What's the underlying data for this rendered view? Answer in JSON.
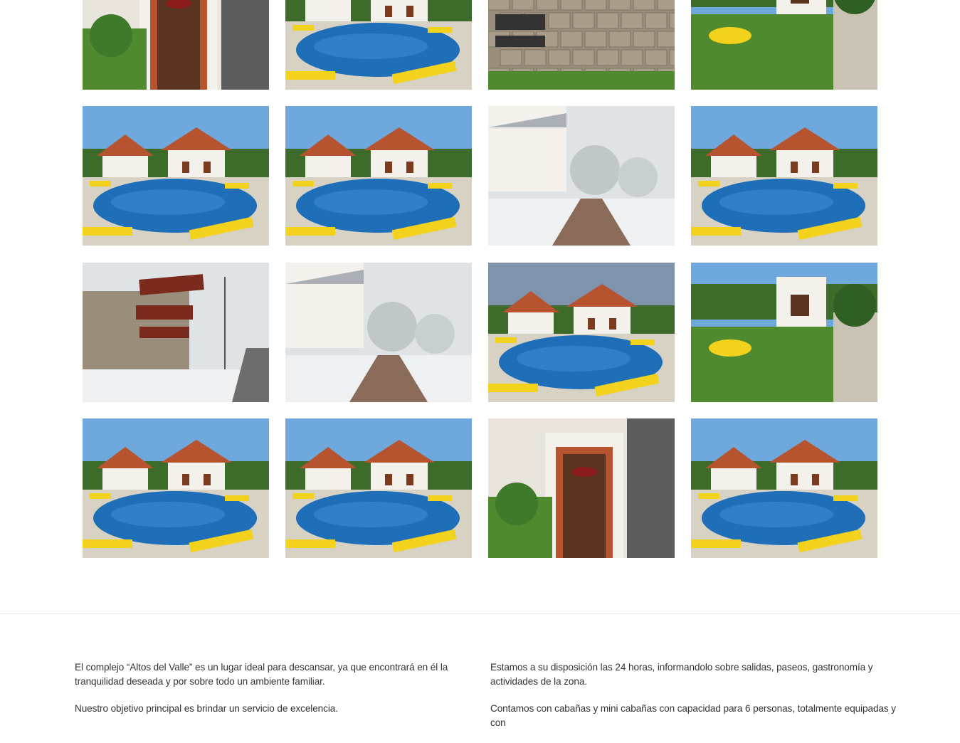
{
  "gallery": {
    "rows": [
      [
        {
          "name": "photo-entrance-night",
          "scene": "entrance",
          "description": "Entrance with door and lamp"
        },
        {
          "name": "photo-pool-day",
          "scene": "pool",
          "description": "Pool with yellow loungers"
        },
        {
          "name": "photo-stone-sign",
          "scene": "stonewall",
          "description": "Stone wall with sign"
        },
        {
          "name": "photo-garden-lawn",
          "scene": "garden",
          "description": "Garden lawn with tables"
        }
      ],
      [
        {
          "name": "photo-pool-house-1",
          "scene": "pool",
          "description": "Pool and houses"
        },
        {
          "name": "photo-pool-fence",
          "scene": "pool",
          "description": "Pool behind fence"
        },
        {
          "name": "photo-snow-path",
          "scene": "snow",
          "description": "Snowy path"
        },
        {
          "name": "photo-pool-house-2",
          "scene": "pool",
          "description": "Pool and houses"
        }
      ],
      [
        {
          "name": "photo-snow-sign",
          "scene": "snowsign",
          "description": "Sign in snow"
        },
        {
          "name": "photo-snow-courtyard",
          "scene": "snow",
          "description": "Snowy courtyard"
        },
        {
          "name": "photo-pool-evening",
          "scene": "pooldusk",
          "description": "Pool at dusk"
        },
        {
          "name": "photo-garden-house",
          "scene": "garden",
          "description": "Garden house"
        }
      ],
      [
        {
          "name": "photo-pool-wide-1",
          "scene": "pool",
          "description": "Wide pool view"
        },
        {
          "name": "photo-pool-wide-2",
          "scene": "pool",
          "description": "Pool with loungers"
        },
        {
          "name": "photo-sauna-door",
          "scene": "entrance",
          "description": "Sauna door"
        },
        {
          "name": "photo-pool-wide-3",
          "scene": "pool",
          "description": "Pool and deck"
        }
      ]
    ]
  },
  "info": {
    "left": {
      "p1": "El complejo “Altos del Valle” es un lugar ideal para descansar, ya que encontrará en él la tranquilidad deseada y por sobre todo un ambiente familiar.",
      "p2": "Nuestro objetivo principal es brindar un servicio de excelencia."
    },
    "right": {
      "p1": "Estamos a su disposición las 24 horas, informandolo sobre salidas, paseos, gastronomía y actividades de la zona.",
      "p2": "Contamos con cabañas y mini cabañas con capacidad para 6 personas, totalmente equipadas y con"
    }
  },
  "colors": {
    "pool": "#1f6fb8",
    "lounger": "#f2d21c",
    "roof": "#b5542f",
    "wall": "#f4f1ec",
    "grass": "#4f8a2e",
    "sky": "#6fa8dc",
    "snow": "#eef0f2",
    "stone": "#9a8d7b",
    "dusk": "#7f93ad"
  }
}
